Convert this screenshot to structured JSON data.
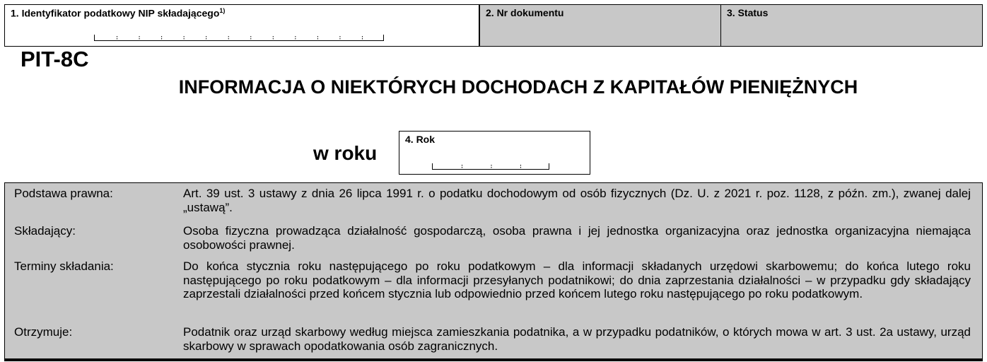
{
  "header": {
    "nip_label": "1. Identyfikator podatkowy NIP składającego",
    "nip_footnote": "1)",
    "doc_number_label": "2. Nr dokumentu",
    "status_label": "3. Status"
  },
  "form": {
    "code": "PIT-8C",
    "title": "INFORMACJA O NIEKTÓRYCH DOCHODACH Z KAPITAŁÓW PIENIĘŻNYCH",
    "year_prefix": "w roku",
    "year_label": "4. Rok"
  },
  "info": {
    "rows": [
      {
        "label": "Podstawa  prawna:",
        "text": "Art. 39 ust. 3 ustawy z dnia 26 lipca 1991 r. o podatku dochodowym od osób fizycznych (Dz. U. z 2021 r. poz. 1128, z późn. zm.), zwanej dalej „ustawą”."
      },
      {
        "label": "Składający:",
        "text": "Osoba fizyczna prowadząca działalność gospodarczą, osoba prawna i jej jednostka organizacyjna oraz jednostka organizacyjna niemająca osobowości prawnej."
      },
      {
        "label": "Terminy składania:",
        "text": "Do końca stycznia roku następującego po roku podatkowym – dla informacji składanych urzędowi skarbowemu; do końca lutego roku następującego po roku podatkowym – dla informacji przesyłanych podatnikowi; do dnia zaprzestania działalności – w przypadku gdy składający zaprzestali działalności przed końcem stycznia lub odpowiednio przed końcem lutego roku następującego po roku podatkowym."
      },
      {
        "label": "Otrzymuje:",
        "text": "Podatnik oraz urząd skarbowy według miejsca zamieszkania podatnika, a w przypadku podatników, o których mowa w art. 3 ust. 2a ustawy, urząd skarbowy w sprawach opodatkowania osób zagranicznych."
      }
    ]
  }
}
